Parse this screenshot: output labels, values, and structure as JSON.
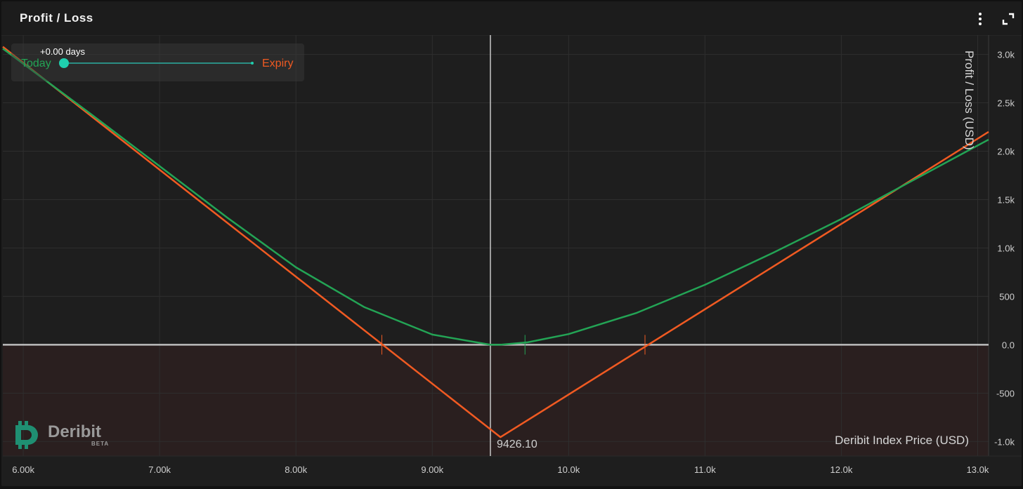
{
  "window": {
    "title": "Profit / Loss"
  },
  "slider": {
    "days_label": "+0.00 days",
    "today_label": "Today",
    "expiry_label": "Expiry",
    "value_days": 0
  },
  "logo": {
    "name": "Deribit",
    "badge": "BETA"
  },
  "colors": {
    "today": "#23a455",
    "expiry": "#f05a22",
    "cursor": "#c8c8c8",
    "zero_line": "#bdbdbd",
    "loss_bg": "#2a1f1f",
    "grid": "#2e2e2e",
    "accent": "#1fcfae"
  },
  "icons": {
    "menu": "vertical-dots-icon",
    "expand": "expand-corners-icon"
  },
  "chart_data": {
    "type": "line",
    "xlabel": "Deribit Index Price   (USD)",
    "ylabel": "Profit / Loss   (USD)",
    "xlim": [
      5850,
      13080
    ],
    "ylim": [
      -1150,
      3200
    ],
    "x_ticks": [
      6000,
      7000,
      8000,
      9000,
      10000,
      11000,
      12000,
      13000
    ],
    "x_tick_labels": [
      "6.00k",
      "7.00k",
      "8.00k",
      "9.00k",
      "10.0k",
      "11.0k",
      "12.0k",
      "13.0k"
    ],
    "y_ticks": [
      3000,
      2500,
      2000,
      1500,
      1000,
      500,
      0,
      -500,
      -1000
    ],
    "y_tick_labels": [
      "3.0k",
      "2.5k",
      "2.0k",
      "1.5k",
      "1.0k",
      "500",
      "0.0",
      "-500",
      "-1.0k"
    ],
    "grid": true,
    "cursor": {
      "x": 9426.1,
      "label": "9426.10"
    },
    "series": [
      {
        "name": "Today",
        "x": [
          5850,
          6500,
          7000,
          7500,
          8000,
          8500,
          9000,
          9426,
          9500,
          9700,
          10000,
          10500,
          11000,
          11500,
          12000,
          12500,
          13080
        ],
        "y": [
          3060,
          2380,
          1845,
          1310,
          800,
          390,
          105,
          0,
          0,
          25,
          110,
          330,
          620,
          950,
          1300,
          1680,
          2120
        ]
      },
      {
        "name": "Expiry",
        "x": [
          5850,
          9500,
          13080
        ],
        "y": [
          3080,
          -955,
          2200
        ]
      }
    ],
    "breakeven_markers": [
      {
        "series": "Expiry",
        "x": 8630
      },
      {
        "series": "Expiry",
        "x": 10560
      },
      {
        "series": "Today",
        "x": 9680
      }
    ]
  }
}
